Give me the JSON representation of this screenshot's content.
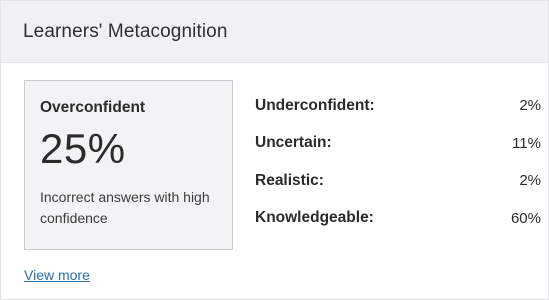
{
  "header": {
    "title": "Learners' Metacognition"
  },
  "highlight": {
    "label": "Overconfident",
    "value": "25%",
    "description": "Incorrect answers with high confidence"
  },
  "stats": [
    {
      "label": "Underconfident:",
      "value": "2%"
    },
    {
      "label": "Uncertain:",
      "value": "11%"
    },
    {
      "label": "Realistic:",
      "value": "2%"
    },
    {
      "label": "Knowledgeable:",
      "value": "60%"
    }
  ],
  "footer": {
    "link_label": "View more"
  },
  "colors": {
    "header_bg": "#eef2f7",
    "box_bg": "#f1f3f5",
    "link": "#2a6fa8"
  }
}
